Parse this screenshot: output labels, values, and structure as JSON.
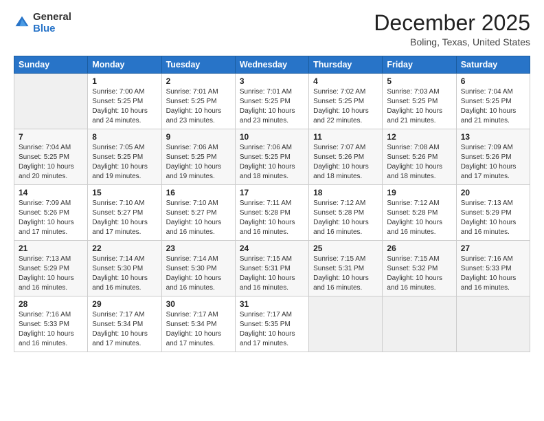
{
  "logo": {
    "general": "General",
    "blue": "Blue"
  },
  "header": {
    "month": "December 2025",
    "location": "Boling, Texas, United States"
  },
  "days_of_week": [
    "Sunday",
    "Monday",
    "Tuesday",
    "Wednesday",
    "Thursday",
    "Friday",
    "Saturday"
  ],
  "weeks": [
    [
      {
        "day": "",
        "info": ""
      },
      {
        "day": "1",
        "info": "Sunrise: 7:00 AM\nSunset: 5:25 PM\nDaylight: 10 hours\nand 24 minutes."
      },
      {
        "day": "2",
        "info": "Sunrise: 7:01 AM\nSunset: 5:25 PM\nDaylight: 10 hours\nand 23 minutes."
      },
      {
        "day": "3",
        "info": "Sunrise: 7:01 AM\nSunset: 5:25 PM\nDaylight: 10 hours\nand 23 minutes."
      },
      {
        "day": "4",
        "info": "Sunrise: 7:02 AM\nSunset: 5:25 PM\nDaylight: 10 hours\nand 22 minutes."
      },
      {
        "day": "5",
        "info": "Sunrise: 7:03 AM\nSunset: 5:25 PM\nDaylight: 10 hours\nand 21 minutes."
      },
      {
        "day": "6",
        "info": "Sunrise: 7:04 AM\nSunset: 5:25 PM\nDaylight: 10 hours\nand 21 minutes."
      }
    ],
    [
      {
        "day": "7",
        "info": "Sunrise: 7:04 AM\nSunset: 5:25 PM\nDaylight: 10 hours\nand 20 minutes."
      },
      {
        "day": "8",
        "info": "Sunrise: 7:05 AM\nSunset: 5:25 PM\nDaylight: 10 hours\nand 19 minutes."
      },
      {
        "day": "9",
        "info": "Sunrise: 7:06 AM\nSunset: 5:25 PM\nDaylight: 10 hours\nand 19 minutes."
      },
      {
        "day": "10",
        "info": "Sunrise: 7:06 AM\nSunset: 5:25 PM\nDaylight: 10 hours\nand 18 minutes."
      },
      {
        "day": "11",
        "info": "Sunrise: 7:07 AM\nSunset: 5:26 PM\nDaylight: 10 hours\nand 18 minutes."
      },
      {
        "day": "12",
        "info": "Sunrise: 7:08 AM\nSunset: 5:26 PM\nDaylight: 10 hours\nand 18 minutes."
      },
      {
        "day": "13",
        "info": "Sunrise: 7:09 AM\nSunset: 5:26 PM\nDaylight: 10 hours\nand 17 minutes."
      }
    ],
    [
      {
        "day": "14",
        "info": "Sunrise: 7:09 AM\nSunset: 5:26 PM\nDaylight: 10 hours\nand 17 minutes."
      },
      {
        "day": "15",
        "info": "Sunrise: 7:10 AM\nSunset: 5:27 PM\nDaylight: 10 hours\nand 17 minutes."
      },
      {
        "day": "16",
        "info": "Sunrise: 7:10 AM\nSunset: 5:27 PM\nDaylight: 10 hours\nand 16 minutes."
      },
      {
        "day": "17",
        "info": "Sunrise: 7:11 AM\nSunset: 5:28 PM\nDaylight: 10 hours\nand 16 minutes."
      },
      {
        "day": "18",
        "info": "Sunrise: 7:12 AM\nSunset: 5:28 PM\nDaylight: 10 hours\nand 16 minutes."
      },
      {
        "day": "19",
        "info": "Sunrise: 7:12 AM\nSunset: 5:28 PM\nDaylight: 10 hours\nand 16 minutes."
      },
      {
        "day": "20",
        "info": "Sunrise: 7:13 AM\nSunset: 5:29 PM\nDaylight: 10 hours\nand 16 minutes."
      }
    ],
    [
      {
        "day": "21",
        "info": "Sunrise: 7:13 AM\nSunset: 5:29 PM\nDaylight: 10 hours\nand 16 minutes."
      },
      {
        "day": "22",
        "info": "Sunrise: 7:14 AM\nSunset: 5:30 PM\nDaylight: 10 hours\nand 16 minutes."
      },
      {
        "day": "23",
        "info": "Sunrise: 7:14 AM\nSunset: 5:30 PM\nDaylight: 10 hours\nand 16 minutes."
      },
      {
        "day": "24",
        "info": "Sunrise: 7:15 AM\nSunset: 5:31 PM\nDaylight: 10 hours\nand 16 minutes."
      },
      {
        "day": "25",
        "info": "Sunrise: 7:15 AM\nSunset: 5:31 PM\nDaylight: 10 hours\nand 16 minutes."
      },
      {
        "day": "26",
        "info": "Sunrise: 7:15 AM\nSunset: 5:32 PM\nDaylight: 10 hours\nand 16 minutes."
      },
      {
        "day": "27",
        "info": "Sunrise: 7:16 AM\nSunset: 5:33 PM\nDaylight: 10 hours\nand 16 minutes."
      }
    ],
    [
      {
        "day": "28",
        "info": "Sunrise: 7:16 AM\nSunset: 5:33 PM\nDaylight: 10 hours\nand 16 minutes."
      },
      {
        "day": "29",
        "info": "Sunrise: 7:17 AM\nSunset: 5:34 PM\nDaylight: 10 hours\nand 17 minutes."
      },
      {
        "day": "30",
        "info": "Sunrise: 7:17 AM\nSunset: 5:34 PM\nDaylight: 10 hours\nand 17 minutes."
      },
      {
        "day": "31",
        "info": "Sunrise: 7:17 AM\nSunset: 5:35 PM\nDaylight: 10 hours\nand 17 minutes."
      },
      {
        "day": "",
        "info": ""
      },
      {
        "day": "",
        "info": ""
      },
      {
        "day": "",
        "info": ""
      }
    ]
  ]
}
